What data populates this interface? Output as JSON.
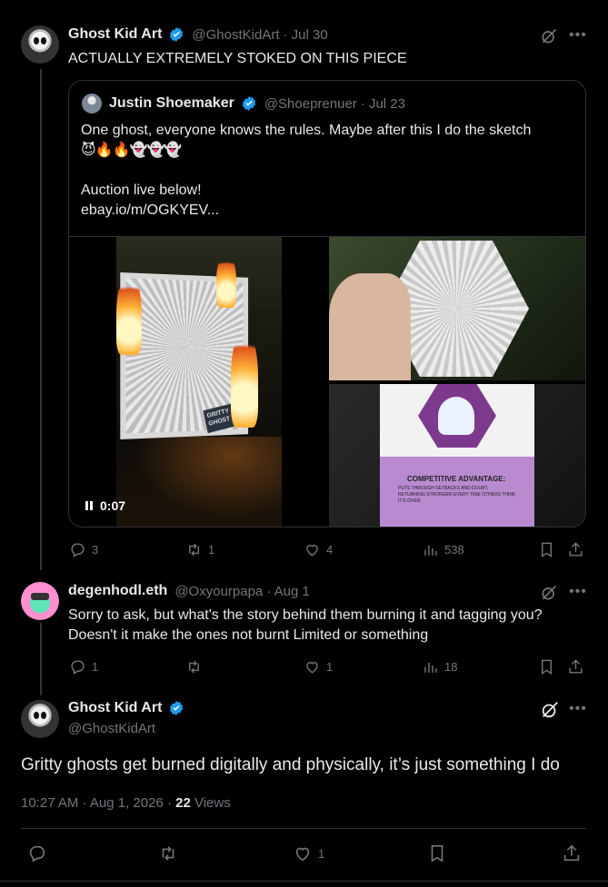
{
  "tweet1": {
    "name": "Ghost Kid Art",
    "handle": "@GhostKidArt",
    "date": "· Jul 30",
    "text": "ACTUALLY EXTREMELY STOKED ON THIS PIECE"
  },
  "quote": {
    "name": "Justin Shoemaker",
    "handle": "@Shoeprenuer",
    "date": "· Jul 23",
    "line1": "One ghost, everyone knows the rules. Maybe after this I do the sketch",
    "emojis": "😈🔥🔥👻👻👻",
    "line2": "Auction live below!",
    "link": "ebay.io/m/OGKYEV...",
    "video_time": "0:07",
    "card_title": "GRITTY GHOST",
    "card_back_heading": "COMPETITIVE ADVANTAGE:",
    "card_back_body": "PUTS THROUGH SETBACKS AND DOUBT, RETURNING STRONGER EVERY TIME OTHERS THINK IT'S OVER."
  },
  "tweet1_actions": {
    "replies": "3",
    "reposts": "1",
    "likes": "4",
    "views": "538"
  },
  "tweet2": {
    "name": "degenhodl.eth",
    "handle": "@Oxyourpapa",
    "date": "· Aug 1",
    "line1": "Sorry to ask, but what's the story behind them burning it and tagging you?",
    "line2": "Doesn't it make the ones not burnt Limited or something"
  },
  "tweet2_actions": {
    "replies": "1",
    "reposts": "",
    "likes": "1",
    "views": "18"
  },
  "main": {
    "name": "Ghost Kid Art",
    "handle": "@GhostKidArt",
    "text": "Gritty ghosts get burned digitally and physically, it’s just something I do",
    "timestamp": "10:27 AM · Aug 1, 2026 · ",
    "views_count": "22",
    "views_label": "Views"
  },
  "main_actions": {
    "likes": "1"
  },
  "colors": {
    "background": "#000000",
    "text": "#e7e9ea",
    "muted": "#71767b",
    "verified": "#1d9bf0",
    "border": "#2f3336"
  }
}
